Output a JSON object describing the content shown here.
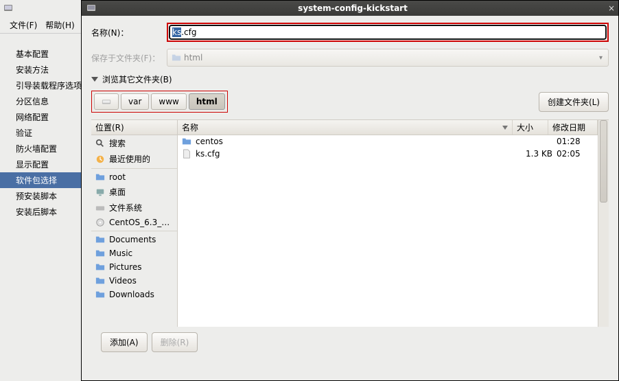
{
  "window_title": "system-config-kickstart",
  "main_menu": {
    "file": "文件(F)",
    "help": "帮助(H)"
  },
  "sidebar": {
    "items": [
      "基本配置",
      "安装方法",
      "引导装载程序选项",
      "分区信息",
      "网络配置",
      "验证",
      "防火墙配置",
      "显示配置",
      "软件包选择",
      "预安装脚本",
      "安装后脚本"
    ],
    "selected_index": 8
  },
  "dialog": {
    "name_label": "名称(N)：",
    "name_value": "ks.cfg",
    "save_label": "保存于文件夹(F)：",
    "save_folder": "html",
    "browse_label": "浏览其它文件夹(B)",
    "breadcrumbs": [
      "var",
      "www",
      "html"
    ],
    "active_crumb": 2,
    "create_folder_btn": "创建文件夹(L)",
    "places_header": "位置(R)",
    "places": {
      "group1": [
        "搜索",
        "最近使用的"
      ],
      "group2": [
        "root",
        "桌面",
        "文件系统",
        "CentOS_6.3_…"
      ],
      "group3": [
        "Documents",
        "Music",
        "Pictures",
        "Videos",
        "Downloads"
      ]
    },
    "col_name": "名称",
    "col_size": "大小",
    "col_date": "修改日期",
    "files": [
      {
        "name": "centos",
        "size": "",
        "date": "01:28",
        "type": "folder"
      },
      {
        "name": "ks.cfg",
        "size": "1.3 KB",
        "date": "02:05",
        "type": "file"
      }
    ],
    "add_btn": "添加(A)",
    "remove_btn": "删除(R)"
  }
}
